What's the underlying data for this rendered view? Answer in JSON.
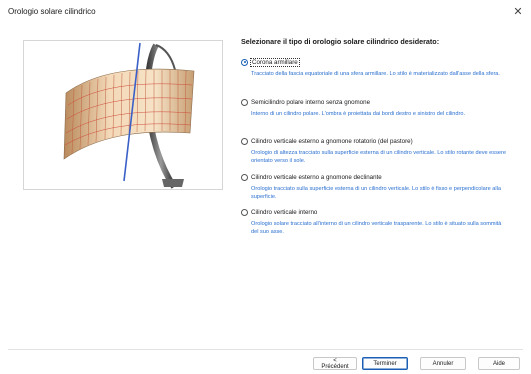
{
  "window": {
    "title": "Orologio solare cilindrico",
    "close_glyph": "✕"
  },
  "heading": "Selezionare il tipo di orologio solare cilindrico desiderato:",
  "options": [
    {
      "label": "Corona armillare",
      "description": "Tracciato della fascia equatoriale di una sfera armillare. Lo stilo è materializzato dall'asse della sfera.",
      "checked": true
    },
    {
      "label": "Semicilindro polare interno senza gnomone",
      "description": "Interno di un cilindro polare. L'ombra è proiettata dai bordi destro e sinistro del cilindro.",
      "checked": false
    },
    {
      "label": "Cilindro verticale esterno a gnomone rotatorio (del pastore)",
      "description": "Orologio di altezza tracciato sulla superficie esterna di un cilindro verticale. Lo stilo rotante deve essere orientato verso il sole.",
      "checked": false
    },
    {
      "label": "Cilindro verticale esterno a gnomone declinante",
      "description": "Orologio tracciato sulla superficie esterna di un cilindro verticale. Lo  stilo è fisso e perpendicolare alla superficie.",
      "checked": false
    },
    {
      "label": "Cilindro verticale interno",
      "description": "Orologio solare tracciato all'interno di un cilindro verticale trasparente. Lo stilo è situato sulla sommità del suo asse.",
      "checked": false
    }
  ],
  "buttons": {
    "back": "< Précédent",
    "finish": "Terminer",
    "cancel": "Annuler",
    "help": "Aide"
  },
  "colors": {
    "accent": "#1a5fb4",
    "description_text": "#2a6fd0"
  }
}
